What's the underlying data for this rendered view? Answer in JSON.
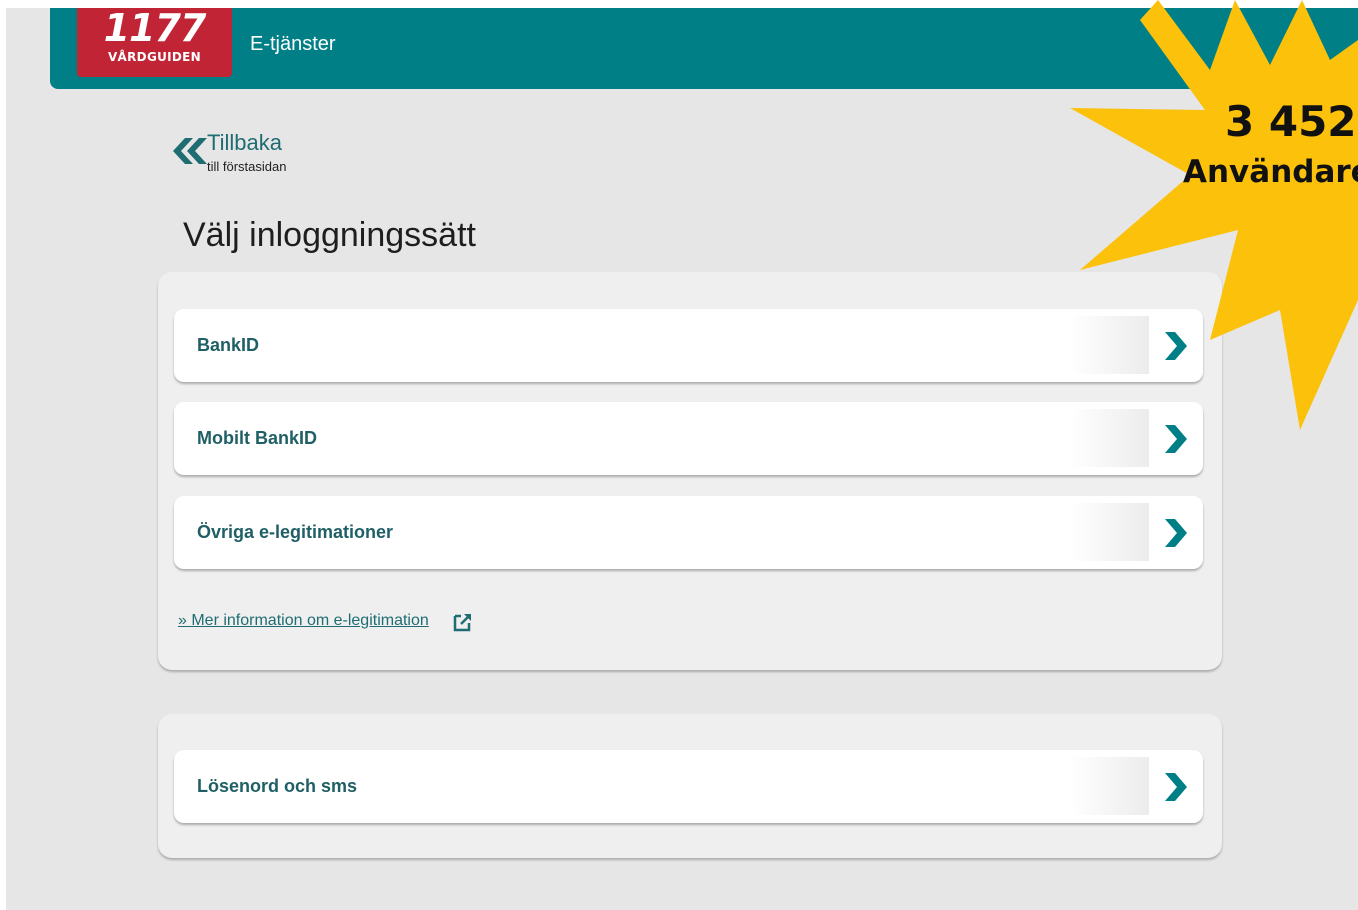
{
  "header": {
    "logo_number": "1177",
    "logo_text": "VÅRDGUIDEN",
    "title": "E-tjänster"
  },
  "back": {
    "title": "Tillbaka",
    "subtitle": "till förstasidan",
    "icon": "double-chevron-left-icon"
  },
  "page": {
    "title": "Välj inloggningssätt"
  },
  "login_options": [
    {
      "label": "BankID"
    },
    {
      "label": "Mobilt BankID"
    },
    {
      "label": "Övriga e-legitimationer"
    }
  ],
  "info": {
    "link_text": "» Mer information om e-legitimation",
    "icon": "external-link-icon"
  },
  "password_option": {
    "label": "Lösenord och sms"
  },
  "badge": {
    "count": "3 452",
    "label": "Användare"
  },
  "colors": {
    "header": "#007f86",
    "logo": "#c12434",
    "link": "#1f6d73",
    "chevron": "#007f86",
    "starburst": "#fbc10b"
  }
}
